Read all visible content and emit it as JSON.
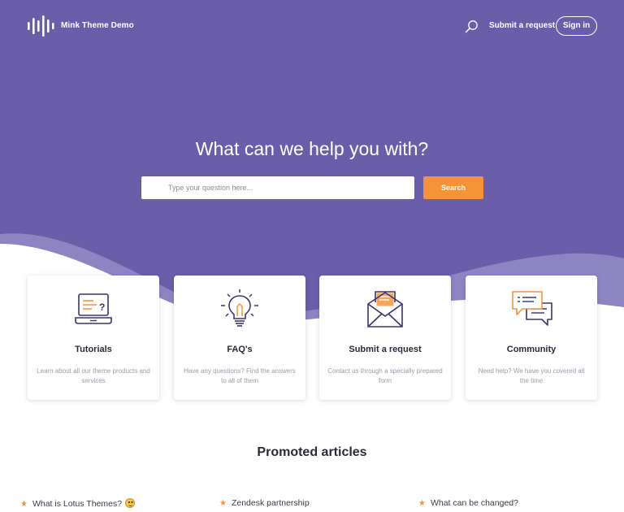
{
  "colors": {
    "hero_primary": "#6a5eaa",
    "hero_wave_light": "#8d85c2",
    "accent": "#f6923a",
    "text_dark": "#2a2a3a",
    "text_muted": "#9a9aa8"
  },
  "header": {
    "brand": "Mink Theme Demo",
    "logo_icon": "soundwave-logo-icon",
    "search_icon": "search-icon",
    "submit_link": "Submit a request",
    "signin_label": "Sign in"
  },
  "hero": {
    "title": "What can we help you with?",
    "search_placeholder": "Type your question here...",
    "search_value": "",
    "search_button": "Search"
  },
  "cards": [
    {
      "icon": "laptop-question-icon",
      "title": "Tutorials",
      "description": "Learn about all our theme products and services"
    },
    {
      "icon": "lightbulb-icon",
      "title": "FAQ's",
      "description": "Have any questions? Find the answers to all of them"
    },
    {
      "icon": "envelope-icon",
      "title": "Submit a request",
      "description": "Contact us through a specially prepared form"
    },
    {
      "icon": "chat-bubbles-icon",
      "title": "Community",
      "description": "Need help? We have you covered all the time"
    }
  ],
  "promoted": {
    "title": "Promoted articles",
    "articles": [
      {
        "title": "What is Lotus Themes?",
        "star_icon": "star-icon",
        "emoji": "smiley-emoji-icon"
      },
      {
        "title": "Zendesk partnership",
        "star_icon": "star-icon"
      },
      {
        "title": "What can be changed?",
        "star_icon": "star-icon"
      }
    ]
  }
}
